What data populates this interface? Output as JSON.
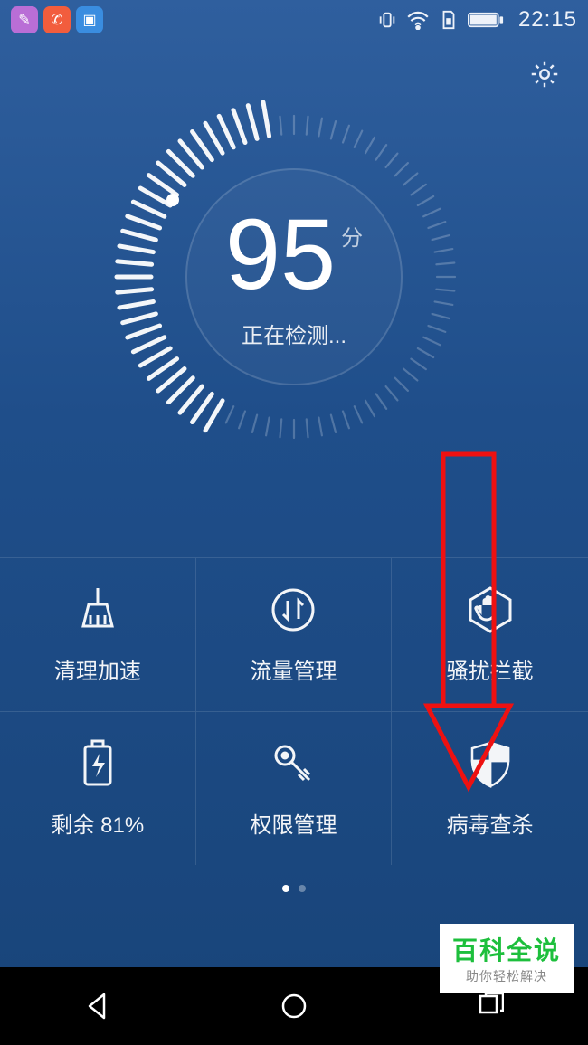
{
  "status_bar": {
    "time": "22:15",
    "icons": [
      "vibrate",
      "wifi-call",
      "sim",
      "battery"
    ]
  },
  "score": {
    "value": "95",
    "unit": "分",
    "status": "正在检测..."
  },
  "features": [
    {
      "icon": "broom",
      "label": "清理加速"
    },
    {
      "icon": "traffic",
      "label": "流量管理"
    },
    {
      "icon": "block",
      "label": "骚扰拦截"
    },
    {
      "icon": "battery",
      "label": "剩余 81%"
    },
    {
      "icon": "key",
      "label": "权限管理"
    },
    {
      "icon": "shield",
      "label": "病毒查杀"
    }
  ],
  "pager": {
    "pages": 2,
    "active": 0
  },
  "watermark": {
    "title": "百科全说",
    "sub": "助你轻松解决"
  }
}
